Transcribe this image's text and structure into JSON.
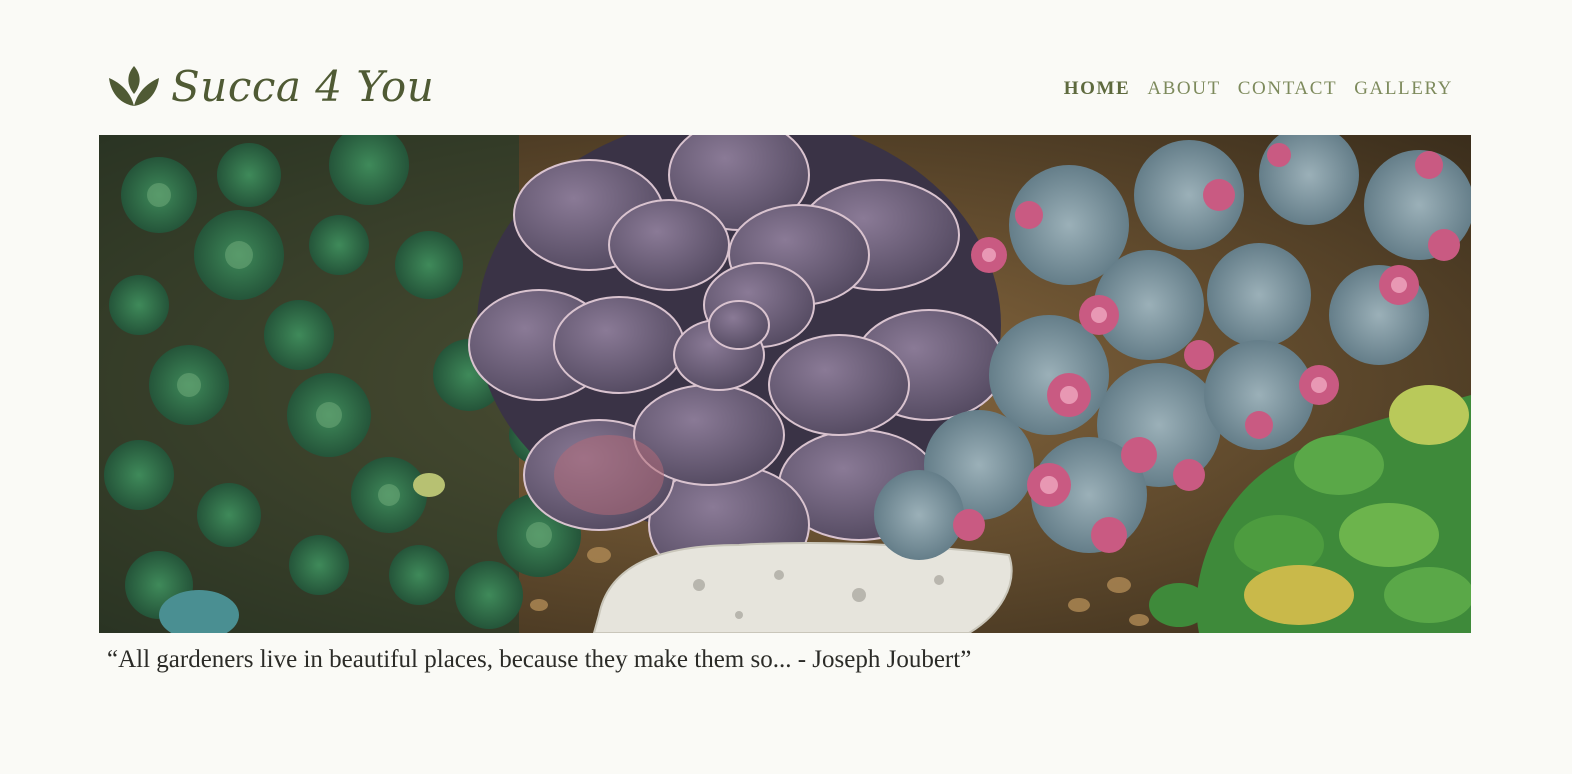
{
  "brand": {
    "name": "Succa 4 You",
    "icon": "lotus-leaf-icon",
    "color": "#4f5a34"
  },
  "nav": {
    "items": [
      {
        "label": "HOME",
        "active": true
      },
      {
        "label": "ABOUT",
        "active": false
      },
      {
        "label": "CONTACT",
        "active": false
      },
      {
        "label": "GALLERY",
        "active": false
      }
    ],
    "color": "#7d8a5c"
  },
  "hero": {
    "subject": "succulent-garden-photo"
  },
  "quote": {
    "text": "“All gardeners live in beautiful places, because they make them so... - Joseph Joubert”"
  },
  "colors": {
    "background": "#fafaf6",
    "text": "#2b2b27"
  }
}
